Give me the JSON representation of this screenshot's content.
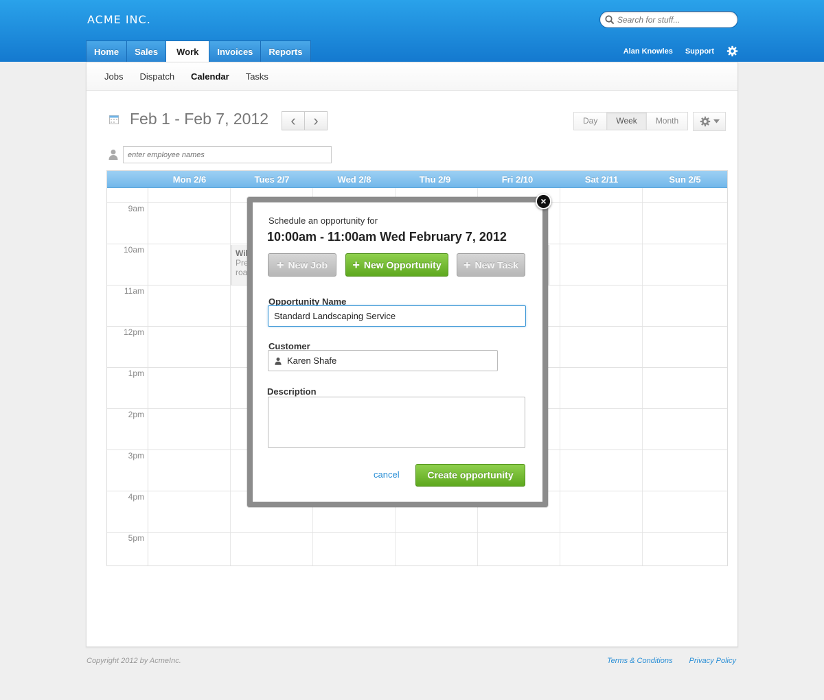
{
  "header": {
    "brand": "ACME INC.",
    "search_placeholder": "Search for stuff...",
    "tabs": [
      {
        "label": "Home",
        "active": false
      },
      {
        "label": "Sales",
        "active": false
      },
      {
        "label": "Work",
        "active": true
      },
      {
        "label": "Invoices",
        "active": false
      },
      {
        "label": "Reports",
        "active": false
      }
    ],
    "user": "Alan Knowles",
    "support": "Support",
    "gear_icon": "gear-icon"
  },
  "subnav": {
    "items": [
      {
        "label": "Jobs",
        "active": false
      },
      {
        "label": "Dispatch",
        "active": false
      },
      {
        "label": "Calendar",
        "active": true
      },
      {
        "label": "Tasks",
        "active": false
      }
    ]
  },
  "toolbar": {
    "date_range": "Feb 1 - Feb 7, 2012",
    "prev": "‹",
    "next": "›",
    "views": [
      {
        "label": "Day",
        "active": false
      },
      {
        "label": "Week",
        "active": true
      },
      {
        "label": "Month",
        "active": false
      }
    ],
    "employee_placeholder": "enter employee names"
  },
  "calendar": {
    "days": [
      "Mon 2/6",
      "Tues 2/7",
      "Wed 2/8",
      "Thu 2/9",
      "Fri 2/10",
      "Sat 2/11",
      "Sun 2/5"
    ],
    "hours": [
      "9am",
      "10am",
      "11am",
      "12pm",
      "1pm",
      "2pm",
      "3pm",
      "4pm",
      "5pm"
    ],
    "event": {
      "title": "Wile",
      "line1": "Prep",
      "line2": "road"
    }
  },
  "modal": {
    "subtitle": "Schedule an opportunity for",
    "title": "10:00am - 11:00am Wed February 7, 2012",
    "buttons": {
      "new_job": "New Job",
      "new_opportunity": "New Opportunity",
      "new_task": "New Task"
    },
    "opportunity_name_label": "Opportunity Name",
    "opportunity_name_value": "Standard Landscaping Service",
    "customer_label": "Customer",
    "customer_value": "Karen Shafe",
    "description_label": "Description",
    "description_value": "",
    "cancel": "cancel",
    "create": "Create opportunity",
    "close_glyph": "×"
  },
  "footer": {
    "copyright": "Copyright 2012 by AcmeInc.",
    "terms": "Terms & Conditions",
    "privacy": "Privacy Policy"
  },
  "colors": {
    "accent": "#1e8fe0",
    "green": "#6cb62a",
    "link": "#2a8fd6"
  }
}
